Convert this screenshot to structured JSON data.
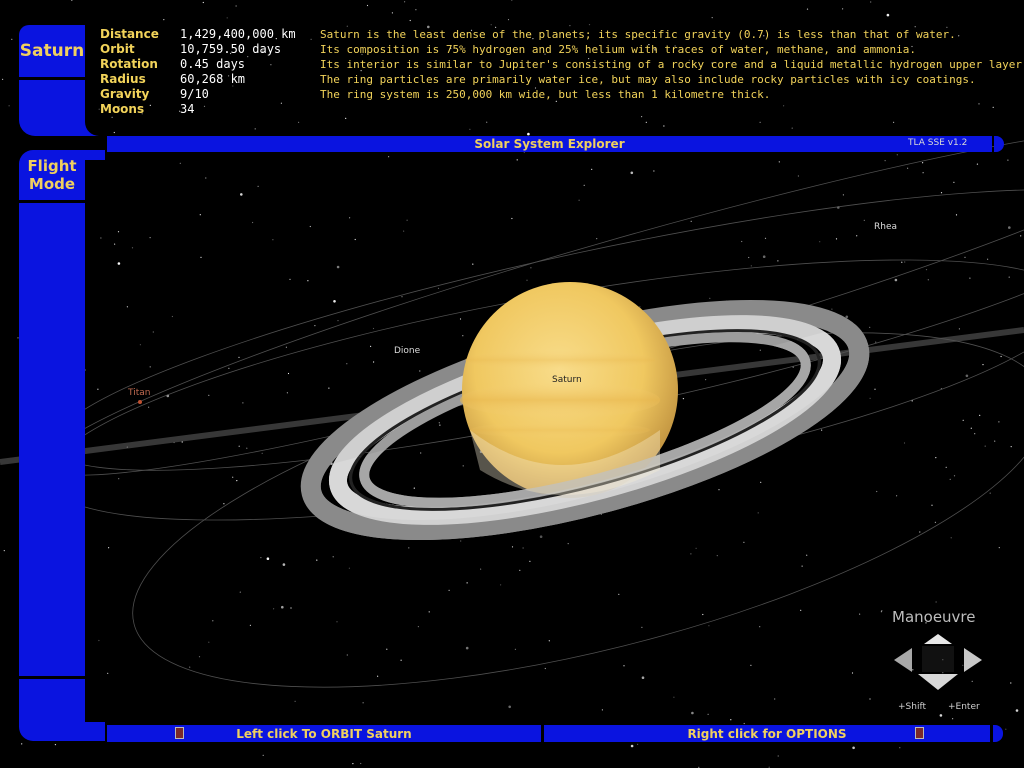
{
  "planet_button": "Saturn",
  "mode_button": "Flight Mode",
  "stats": [
    {
      "label": "Distance",
      "value": "1,429,400,000 km"
    },
    {
      "label": "Orbit",
      "value": "10,759.50 days"
    },
    {
      "label": "Rotation",
      "value": "0.45 days"
    },
    {
      "label": "Radius",
      "value": "60,268 km"
    },
    {
      "label": "Gravity",
      "value": "9/10"
    },
    {
      "label": "Moons",
      "value": "34"
    }
  ],
  "facts": [
    "Saturn is the least dense of the planets; its specific gravity (0.7) is less than that of water.",
    "Its composition is 75% hydrogen and 25% helium with traces of water, methane, and ammonia.",
    "Its interior is similar to Jupiter's consisting of a rocky core and a liquid metallic hydrogen upper layer.",
    "The ring particles are primarily water ice, but may also include rocky particles with icy coatings.",
    "The ring system is 250,000 km wide, but less than 1 kilometre thick."
  ],
  "title_bar": {
    "title": "Solar System Explorer",
    "version": "TLA SSE v1.2"
  },
  "bottom_bar": {
    "left": "Left click To ORBIT Saturn",
    "right": "Right click for OPTIONS"
  },
  "scene": {
    "planet_label": "Saturn",
    "moons": [
      "Titan",
      "Dione",
      "Rhea"
    ]
  },
  "manoeuvre": {
    "title": "Manoeuvre",
    "shift": "+Shift",
    "enter": "+Enter"
  },
  "colors": {
    "lcars_blue": "#0a14e0",
    "label_gold": "#f2d35a",
    "saturn": "#f0c860"
  }
}
